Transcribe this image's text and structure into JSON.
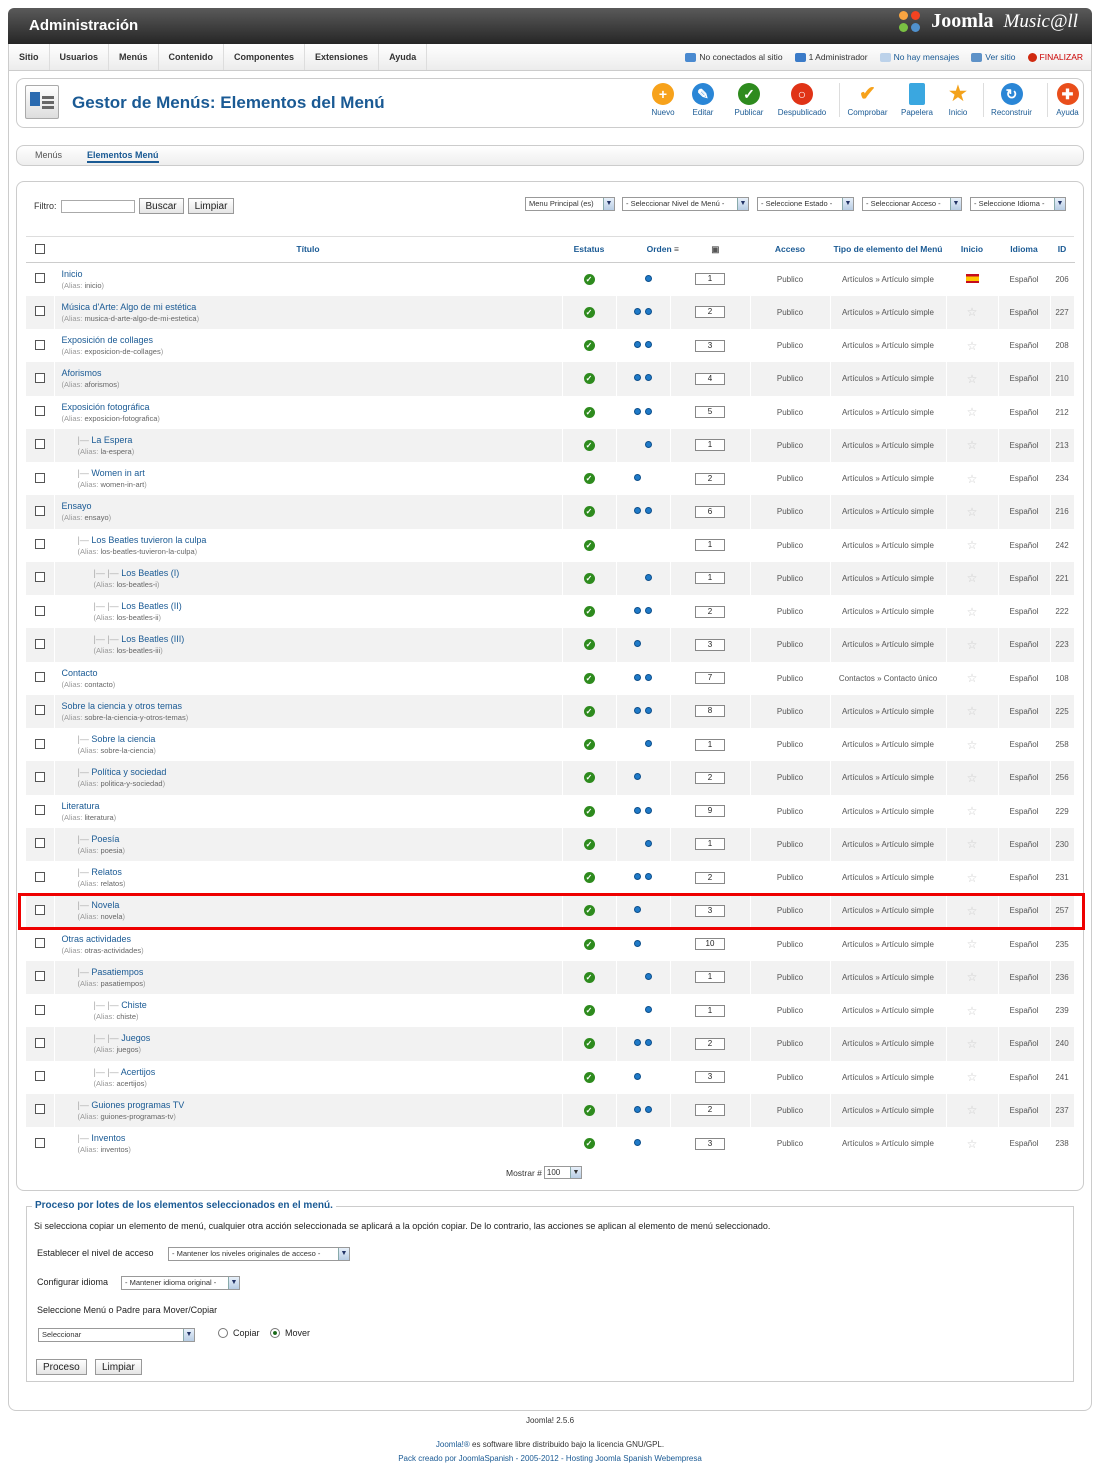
{
  "header": {
    "title": "Administración",
    "brand": "Joomla",
    "brand2": "Music@ll"
  },
  "menubar": {
    "items": [
      "Sitio",
      "Usuarios",
      "Menús",
      "Contenido",
      "Componentes",
      "Extensiones",
      "Ayuda"
    ],
    "status": {
      "not_connected": "No conectados al sitio",
      "admins": "1 Administrador",
      "messages": "No hay mensajes",
      "view_site": "Ver sitio",
      "logout": "FINALIZAR"
    }
  },
  "toolbar": {
    "title": "Gestor de Menús: Elementos del Menú",
    "buttons": [
      "Nuevo",
      "Editar",
      "Publicar",
      "Despublicado",
      "Comprobar",
      "Papelera",
      "Inicio",
      "Reconstruir",
      "Ayuda"
    ]
  },
  "subnav": {
    "tabs": [
      "Menús",
      "Elementos Menú"
    ]
  },
  "filter": {
    "label": "Filtro:",
    "value": "",
    "search": "Buscar",
    "clear": "Limpiar",
    "selects": [
      "Menu Principal (es)",
      "- Seleccionar Nivel de Menú -",
      "- Seleccione Estado -",
      "- Seleccionar Acceso -",
      "- Seleccione Idioma -"
    ]
  },
  "table": {
    "headers": {
      "title": "Título",
      "status": "Estatus",
      "order": "Orden",
      "access": "Acceso",
      "type": "Tipo de elemento del Menú",
      "home": "Inicio",
      "language": "Idioma",
      "id": "ID"
    },
    "alias_label": "Alias:",
    "rows": [
      {
        "title": "Inicio",
        "alias": "inicio",
        "level": 0,
        "up": false,
        "down": true,
        "order": "1",
        "access": "Publico",
        "type": "Artículos » Artículo simple",
        "home": true,
        "language": "Español",
        "id": "206"
      },
      {
        "title": "Música d'Arte: Algo de mi estética",
        "alias": "musica-d-arte-algo-de-mi-estetica",
        "level": 0,
        "up": true,
        "down": true,
        "order": "2",
        "access": "Publico",
        "type": "Artículos » Artículo simple",
        "home": false,
        "language": "Español",
        "id": "227"
      },
      {
        "title": "Exposición de collages",
        "alias": "exposicion-de-collages",
        "level": 0,
        "up": true,
        "down": true,
        "order": "3",
        "access": "Publico",
        "type": "Artículos » Artículo simple",
        "home": false,
        "language": "Español",
        "id": "208"
      },
      {
        "title": "Aforismos",
        "alias": "aforismos",
        "level": 0,
        "up": true,
        "down": true,
        "order": "4",
        "access": "Publico",
        "type": "Artículos » Artículo simple",
        "home": false,
        "language": "Español",
        "id": "210"
      },
      {
        "title": "Exposición fotográfica",
        "alias": "exposicion-fotografica",
        "level": 0,
        "up": true,
        "down": true,
        "order": "5",
        "access": "Publico",
        "type": "Artículos » Artículo simple",
        "home": false,
        "language": "Español",
        "id": "212"
      },
      {
        "title": "La Espera",
        "alias": "la-espera",
        "level": 1,
        "up": false,
        "down": true,
        "order": "1",
        "access": "Publico",
        "type": "Artículos » Artículo simple",
        "home": false,
        "language": "Español",
        "id": "213"
      },
      {
        "title": "Women in art",
        "alias": "women-in-art",
        "level": 1,
        "up": true,
        "down": false,
        "order": "2",
        "access": "Publico",
        "type": "Artículos » Artículo simple",
        "home": false,
        "language": "Español",
        "id": "234"
      },
      {
        "title": "Ensayo",
        "alias": "ensayo",
        "level": 0,
        "up": true,
        "down": true,
        "order": "6",
        "access": "Publico",
        "type": "Artículos » Artículo simple",
        "home": false,
        "language": "Español",
        "id": "216"
      },
      {
        "title": "Los Beatles tuvieron la culpa",
        "alias": "los-beatles-tuvieron-la-culpa",
        "level": 1,
        "up": false,
        "down": false,
        "order": "1",
        "access": "Publico",
        "type": "Artículos » Artículo simple",
        "home": false,
        "language": "Español",
        "id": "242"
      },
      {
        "title": "Los Beatles (I)",
        "alias": "los-beatles-i",
        "level": 2,
        "up": false,
        "down": true,
        "order": "1",
        "access": "Publico",
        "type": "Artículos » Artículo simple",
        "home": false,
        "language": "Español",
        "id": "221"
      },
      {
        "title": "Los Beatles (II)",
        "alias": "los-beatles-ii",
        "level": 2,
        "up": true,
        "down": true,
        "order": "2",
        "access": "Publico",
        "type": "Artículos » Artículo simple",
        "home": false,
        "language": "Español",
        "id": "222"
      },
      {
        "title": "Los Beatles (III)",
        "alias": "los-beatles-iii",
        "level": 2,
        "up": true,
        "down": false,
        "order": "3",
        "access": "Publico",
        "type": "Artículos » Artículo simple",
        "home": false,
        "language": "Español",
        "id": "223"
      },
      {
        "title": "Contacto",
        "alias": "contacto",
        "level": 0,
        "up": true,
        "down": true,
        "order": "7",
        "access": "Publico",
        "type": "Contactos » Contacto único",
        "home": false,
        "language": "Español",
        "id": "108"
      },
      {
        "title": "Sobre la ciencia y otros temas",
        "alias": "sobre-la-ciencia-y-otros-temas",
        "level": 0,
        "up": true,
        "down": true,
        "order": "8",
        "access": "Publico",
        "type": "Artículos » Artículo simple",
        "home": false,
        "language": "Español",
        "id": "225"
      },
      {
        "title": "Sobre la ciencia",
        "alias": "sobre-la-ciencia",
        "level": 1,
        "up": false,
        "down": true,
        "order": "1",
        "access": "Publico",
        "type": "Artículos » Artículo simple",
        "home": false,
        "language": "Español",
        "id": "258"
      },
      {
        "title": "Política y sociedad",
        "alias": "politica-y-sociedad",
        "level": 1,
        "up": true,
        "down": false,
        "order": "2",
        "access": "Publico",
        "type": "Artículos » Artículo simple",
        "home": false,
        "language": "Español",
        "id": "256"
      },
      {
        "title": "Literatura",
        "alias": "literatura",
        "level": 0,
        "up": true,
        "down": true,
        "order": "9",
        "access": "Publico",
        "type": "Artículos » Artículo simple",
        "home": false,
        "language": "Español",
        "id": "229"
      },
      {
        "title": "Poesía",
        "alias": "poesia",
        "level": 1,
        "up": false,
        "down": true,
        "order": "1",
        "access": "Publico",
        "type": "Artículos » Artículo simple",
        "home": false,
        "language": "Español",
        "id": "230"
      },
      {
        "title": "Relatos",
        "alias": "relatos",
        "level": 1,
        "up": true,
        "down": true,
        "order": "2",
        "access": "Publico",
        "type": "Artículos » Artículo simple",
        "home": false,
        "language": "Español",
        "id": "231"
      },
      {
        "title": "Novela",
        "alias": "novela",
        "level": 1,
        "up": true,
        "down": false,
        "order": "3",
        "access": "Publico",
        "type": "Artículos » Artículo simple",
        "home": false,
        "language": "Español",
        "id": "257"
      },
      {
        "title": "Otras actividades",
        "alias": "otras-actividades",
        "level": 0,
        "up": true,
        "down": false,
        "order": "10",
        "access": "Publico",
        "type": "Artículos » Artículo simple",
        "home": false,
        "language": "Español",
        "id": "235"
      },
      {
        "title": "Pasatiempos",
        "alias": "pasatiempos",
        "level": 1,
        "up": false,
        "down": true,
        "order": "1",
        "access": "Publico",
        "type": "Artículos » Artículo simple",
        "home": false,
        "language": "Español",
        "id": "236"
      },
      {
        "title": "Chiste",
        "alias": "chiste",
        "level": 2,
        "up": false,
        "down": true,
        "order": "1",
        "access": "Publico",
        "type": "Artículos » Artículo simple",
        "home": false,
        "language": "Español",
        "id": "239"
      },
      {
        "title": "Juegos",
        "alias": "juegos",
        "level": 2,
        "up": true,
        "down": true,
        "order": "2",
        "access": "Publico",
        "type": "Artículos » Artículo simple",
        "home": false,
        "language": "Español",
        "id": "240"
      },
      {
        "title": "Acertijos",
        "alias": "acertijos",
        "level": 2,
        "up": true,
        "down": false,
        "order": "3",
        "access": "Publico",
        "type": "Artículos » Artículo simple",
        "home": false,
        "language": "Español",
        "id": "241"
      },
      {
        "title": "Guiones programas TV",
        "alias": "guiones-programas-tv",
        "level": 1,
        "up": true,
        "down": true,
        "order": "2",
        "access": "Publico",
        "type": "Artículos » Artículo simple",
        "home": false,
        "language": "Español",
        "id": "237"
      },
      {
        "title": "Inventos",
        "alias": "inventos",
        "level": 1,
        "up": true,
        "down": false,
        "order": "3",
        "access": "Publico",
        "type": "Artículos » Artículo simple",
        "home": false,
        "language": "Español",
        "id": "238"
      }
    ]
  },
  "pagination": {
    "label": "Mostrar #",
    "value": "100"
  },
  "batch": {
    "legend": "Proceso por lotes de los elementos seleccionados en el menú.",
    "note": "Si selecciona copiar un elemento de menú, cualquier otra acción seleccionada se aplicará a la opción copiar. De lo contrario, las acciones se aplican al elemento de menú seleccionado.",
    "access_label": "Establecer el nivel de acceso",
    "access_value": "- Mantener los niveles originales de acceso -",
    "lang_label": "Configurar idioma",
    "lang_value": "- Mantener idioma original -",
    "move_label": "Seleccione Menú o Padre para Mover/Copiar",
    "move_value": "Seleccionar",
    "copy": "Copiar",
    "move": "Mover",
    "process": "Proceso",
    "clear": "Limpiar"
  },
  "footer": {
    "version": "Joomla! 2.5.6",
    "license_link": "Joomla!®",
    "license_text": " es software libre distribuido bajo la licencia GNU/GPL.",
    "pack": "Pack creado por JoomlaSpanish - 2005-2012 - Hosting Joomla Spanish Webempresa"
  }
}
